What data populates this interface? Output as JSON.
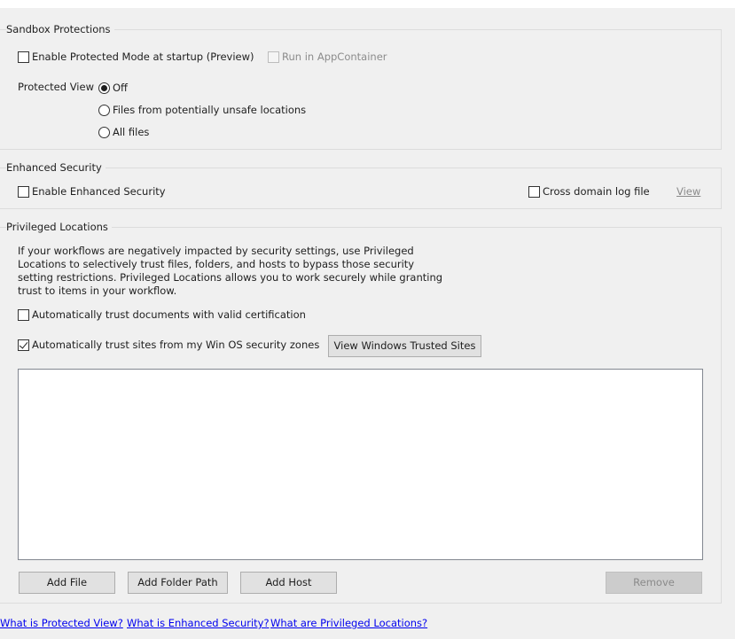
{
  "sandbox": {
    "title": "Sandbox Protections",
    "protected_mode_label": "Enable Protected Mode at startup (Preview)",
    "protected_mode_checked": false,
    "appcontainer_label": "Run in AppContainer",
    "appcontainer_enabled": false,
    "protected_view_label": "Protected View",
    "protected_view_options": [
      {
        "label": "Off",
        "selected": true
      },
      {
        "label": "Files from potentially unsafe locations",
        "selected": false
      },
      {
        "label": "All files",
        "selected": false
      }
    ]
  },
  "enhanced": {
    "title": "Enhanced Security",
    "enable_label": "Enable Enhanced Security",
    "enable_checked": false,
    "cross_domain_label": "Cross domain log file",
    "cross_domain_checked": false,
    "view_link": "View"
  },
  "privileged": {
    "title": "Privileged Locations",
    "description": "If your workflows are negatively impacted by security settings, use Privileged Locations to selectively trust files, folders, and hosts to bypass those security setting restrictions. Privileged Locations allows you to work securely while granting trust to items in your workflow.",
    "trust_cert_label": "Automatically trust documents with valid certification",
    "trust_cert_checked": false,
    "trust_sites_label": "Automatically trust sites from my Win OS security zones",
    "trust_sites_checked": true,
    "view_trusted_button": "View Windows Trusted Sites",
    "locations": [],
    "add_file_button": "Add File",
    "add_folder_button": "Add Folder Path",
    "add_host_button": "Add Host",
    "remove_button": "Remove"
  },
  "links": {
    "protected_view": "What is Protected View?",
    "enhanced_security": "What is Enhanced Security?",
    "privileged_locations": "What are Privileged Locations?"
  }
}
